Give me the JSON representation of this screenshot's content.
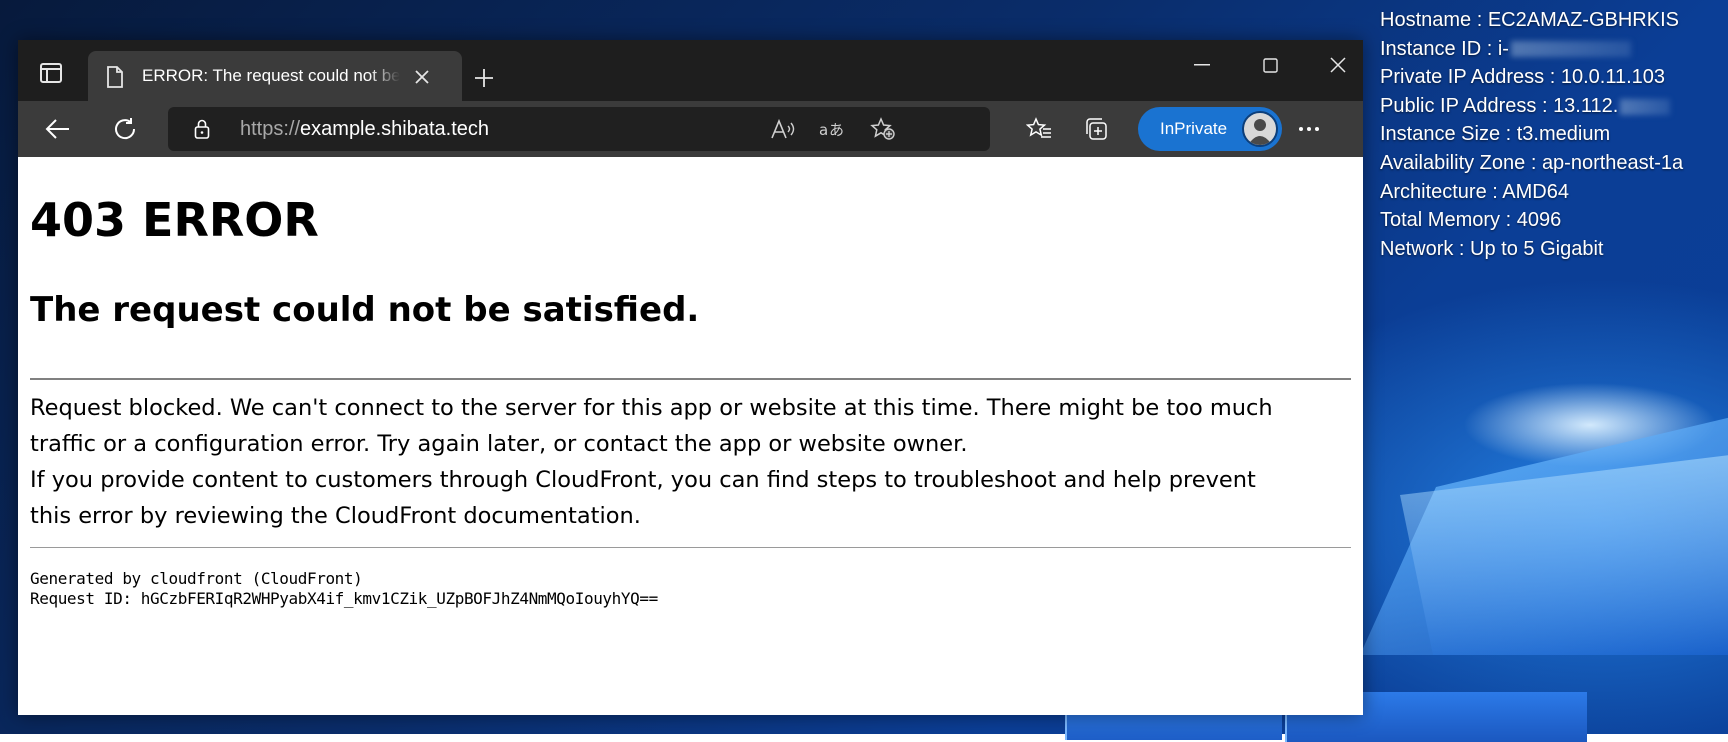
{
  "desktop": {
    "info_lines": [
      {
        "label": "Hostname",
        "value": "EC2AMAZ-GBHRKIS",
        "redacted": false
      },
      {
        "label": "Instance ID",
        "value": "i-",
        "redacted": true
      },
      {
        "label": "Private IP Address",
        "value": "10.0.11.103",
        "redacted": false
      },
      {
        "label": "Public IP Address",
        "value": "13.112.",
        "redacted": true
      },
      {
        "label": "Instance Size",
        "value": "t3.medium",
        "redacted": false
      },
      {
        "label": "Availability Zone",
        "value": "ap-northeast-1a",
        "redacted": false
      },
      {
        "label": "Architecture",
        "value": "AMD64",
        "redacted": false
      },
      {
        "label": "Total Memory",
        "value": "4096",
        "redacted": false
      },
      {
        "label": "Network",
        "value": "Up to 5 Gigabit",
        "redacted": false
      }
    ],
    "separator": " : "
  },
  "browser": {
    "tab": {
      "title": "ERROR: The request could not be satisfied",
      "icon": "page-icon"
    },
    "address_bar": {
      "protocol": "https://",
      "host": "example.shibata.tech"
    },
    "inprivate_label": "InPrivate",
    "theme_colors": {
      "tabbar": "#1e1e1e",
      "toolbar": "#3b3b3b",
      "inprivate": "#1a73d1"
    }
  },
  "page": {
    "heading": "403 ERROR",
    "subheading": "The request could not be satisfied.",
    "paragraph_lines": [
      "Request blocked. We can't connect to the server for this app or website at this time. There might be too much",
      "traffic or a configuration error. Try again later, or contact the app or website owner.",
      "If you provide content to customers through CloudFront, you can find steps to troubleshoot and help prevent",
      "this error by reviewing the CloudFront documentation."
    ],
    "generated_by": "Generated by cloudfront (CloudFront)",
    "request_id": "Request ID: hGCzbFERIqR2WHPyabX4if_kmv1CZik_UZpBOFJhZ4NmMQoIouyhYQ=="
  }
}
